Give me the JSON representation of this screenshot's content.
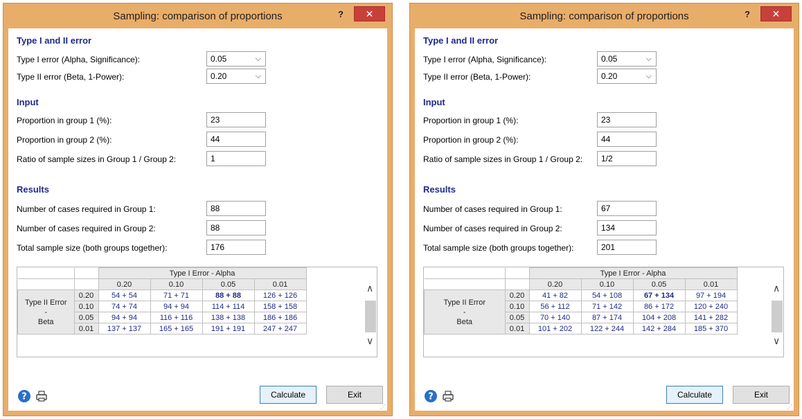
{
  "windows": [
    {
      "title": "Sampling: comparison of proportions",
      "help_label": "?",
      "close_label": "✕",
      "sections": {
        "error": "Type I and II error",
        "input": "Input",
        "results": "Results"
      },
      "labels": {
        "alpha": "Type I error (Alpha, Significance):",
        "beta": "Type II error (Beta, 1-Power):",
        "p1": "Proportion in group 1 (%):",
        "p2": "Proportion in group 2 (%):",
        "ratio": "Ratio of sample sizes in Group 1 / Group 2:",
        "n1": "Number of cases required in Group 1:",
        "n2": "Number of cases required in Group 2:",
        "total": "Total sample size (both groups together):"
      },
      "values": {
        "alpha": "0.05",
        "beta": "0.20",
        "p1": "23",
        "p2": "44",
        "ratio": "1",
        "n1": "88",
        "n2": "88",
        "total": "176"
      },
      "table": {
        "alpha_header": "Type I Error - Alpha",
        "alpha_cols": [
          "0.20",
          "0.10",
          "0.05",
          "0.01"
        ],
        "beta_label_1": "Type II Error",
        "beta_label_2": "-",
        "beta_label_3": "Beta",
        "beta_rows": [
          "0.20",
          "0.10",
          "0.05",
          "0.01"
        ],
        "cells": [
          [
            "54 + 54",
            "71 + 71",
            "88 + 88",
            "126 + 126"
          ],
          [
            "74 + 74",
            "94 + 94",
            "114 + 114",
            "158 + 158"
          ],
          [
            "94 + 94",
            "116 + 116",
            "138 + 138",
            "186 + 186"
          ],
          [
            "137 + 137",
            "165 + 165",
            "191 + 191",
            "247 + 247"
          ]
        ]
      },
      "buttons": {
        "calculate": "Calculate",
        "exit": "Exit"
      },
      "icons": [
        "help-icon",
        "print-icon"
      ]
    },
    {
      "title": "Sampling: comparison of proportions",
      "help_label": "?",
      "close_label": "✕",
      "sections": {
        "error": "Type I and II error",
        "input": "Input",
        "results": "Results"
      },
      "labels": {
        "alpha": "Type I error (Alpha, Significance):",
        "beta": "Type II error (Beta, 1-Power):",
        "p1": "Proportion in group 1 (%):",
        "p2": "Proportion in group 2 (%):",
        "ratio": "Ratio of sample sizes in Group 1 / Group 2:",
        "n1": "Number of cases required in Group 1:",
        "n2": "Number of cases required in Group 2:",
        "total": "Total sample size (both groups together):"
      },
      "values": {
        "alpha": "0.05",
        "beta": "0.20",
        "p1": "23",
        "p2": "44",
        "ratio": "1/2",
        "n1": "67",
        "n2": "134",
        "total": "201"
      },
      "table": {
        "alpha_header": "Type I Error - Alpha",
        "alpha_cols": [
          "0.20",
          "0.10",
          "0.05",
          "0.01"
        ],
        "beta_label_1": "Type II Error",
        "beta_label_2": "-",
        "beta_label_3": "Beta",
        "beta_rows": [
          "0.20",
          "0.10",
          "0.05",
          "0.01"
        ],
        "cells": [
          [
            "41 + 82",
            "54 + 108",
            "67 + 134",
            "97 + 194"
          ],
          [
            "56 + 112",
            "71 + 142",
            "86 + 172",
            "120 + 240"
          ],
          [
            "70 + 140",
            "87 + 174",
            "104 + 208",
            "141 + 282"
          ],
          [
            "101 + 202",
            "122 + 244",
            "142 + 284",
            "185 + 370"
          ]
        ]
      },
      "buttons": {
        "calculate": "Calculate",
        "exit": "Exit"
      },
      "icons": [
        "help-icon",
        "print-icon"
      ]
    }
  ],
  "colors": {
    "titlebar": "#e9ad6a",
    "close": "#c8403a",
    "section": "#1f2a8a",
    "value_text": "#1f2a8a"
  }
}
